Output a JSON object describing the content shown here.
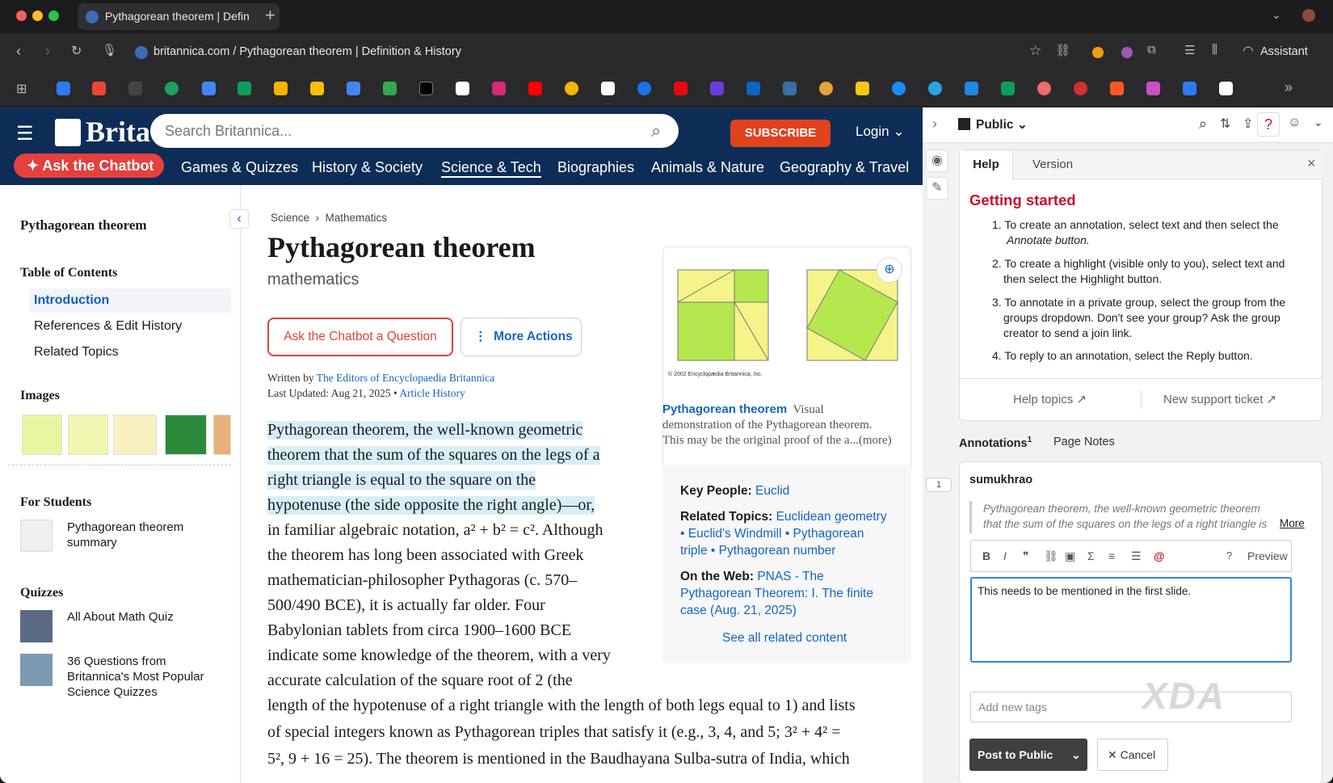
{
  "browser": {
    "tab_title": "Pythagorean theorem | Defin",
    "url": "britannica.com / Pythagorean theorem | Definition & History",
    "assistant": "Assistant"
  },
  "header": {
    "logo": "Brita",
    "search_placeholder": "Search Britannica...",
    "subscribe": "SUBSCRIBE",
    "login": "Login",
    "chatbot": "Ask the Chatbot",
    "nav": [
      "Games & Quizzes",
      "History & Society",
      "Science & Tech",
      "Biographies",
      "Animals & Nature",
      "Geography & Travel"
    ]
  },
  "sidebar": {
    "title": "Pythagorean theorem",
    "toc_heading": "Table of Contents",
    "toc": [
      "Introduction",
      "References & Edit History",
      "Related Topics"
    ],
    "images_heading": "Images",
    "students_heading": "For Students",
    "student_item": "Pythagorean theorem summary",
    "quizzes_heading": "Quizzes",
    "quizzes": [
      "All About Math Quiz",
      "36 Questions from Britannica's Most Popular Science Quizzes"
    ]
  },
  "article": {
    "breadcrumb": [
      "Science",
      "Mathematics"
    ],
    "title": "Pythagorean theorem",
    "subtitle": "mathematics",
    "ask_button": "Ask the Chatbot a Question",
    "more_actions": "More Actions",
    "written_by": "Written by",
    "authors": "The Editors of Encyclopaedia Britannica",
    "last_updated": "Last Updated: Aug 21, 2025",
    "article_history": "Article History",
    "lines": [
      "Pythagorean theorem, the well-known geometric",
      "theorem that the sum of the squares on the legs of a",
      "right triangle is equal to the square on the",
      "hypotenuse (the side opposite the right angle)—or,",
      "in familiar algebraic notation, a² + b² = c². Although",
      "the theorem has long been associated with Greek",
      "mathematician-philosopher Pythagoras (c. 570–",
      "500/490 BCE), it is actually far older. Four",
      "Babylonian tablets from circa 1900–1600 BCE",
      "indicate some knowledge of the theorem, with a very",
      "accurate calculation of the square root of 2 (the",
      "length of the hypotenuse of a right triangle with the length of both legs equal to 1) and lists",
      "of special integers known as Pythagorean triples that satisfy it (e.g., 3, 4, and 5; 3² + 4² =",
      "5², 9 + 16 = 25). The theorem is mentioned in the Baudhayana Sulba-sutra of India, which"
    ]
  },
  "figure": {
    "copyright": "© 2002 Encyclopædia Britannica, Inc.",
    "caption_title": "Pythagorean theorem",
    "caption_lines": [
      "Visual",
      "demonstration of the Pythagorean theorem.",
      "This may be the original proof of the a...(more)"
    ]
  },
  "related": {
    "key_people_label": "Key People:",
    "key_people": "Euclid",
    "topics_label": "Related Topics:",
    "topics_lines": [
      "Euclidean geometry",
      "• Euclid's Windmill • Pythagorean",
      "triple • Pythagorean number"
    ],
    "web_label": "On the Web:",
    "web_lines": [
      "PNAS - The",
      "Pythagorean Theorem: I. The finite",
      "case (Aug. 21, 2025)"
    ],
    "see_all": "See all related content"
  },
  "hypothesis": {
    "group": "Public",
    "tabs": [
      "Help",
      "Version"
    ],
    "getting_started": "Getting started",
    "steps": [
      "1. To create an annotation, select text and then select the",
      "Annotate button.",
      "2. To create a highlight (visible only to you), select text and",
      "then select the Highlight button.",
      "3. To annotate in a private group, select the group from the",
      "groups dropdown. Don't see your group? Ask the group",
      "creator to send a join link.",
      "4. To reply to an annotation, select the Reply button."
    ],
    "help_topics": "Help topics ↗",
    "support": "New support ticket ↗",
    "annotations_tab": "Annotations",
    "annotations_count": "1",
    "page_notes": "Page Notes",
    "anchor_count": "1",
    "user": "sumukhrao",
    "quote_lines": [
      "Pythagorean theorem, the well-known geometric theorem",
      "that the sum of the squares on the legs of a right triangle is"
    ],
    "more": "More",
    "preview": "Preview",
    "help_q": "?",
    "editor_text": "This needs to be mentioned in the first slide.",
    "tags_placeholder": "Add new tags",
    "post": "Post to Public",
    "cancel": "Cancel",
    "watermark": "XDA"
  }
}
